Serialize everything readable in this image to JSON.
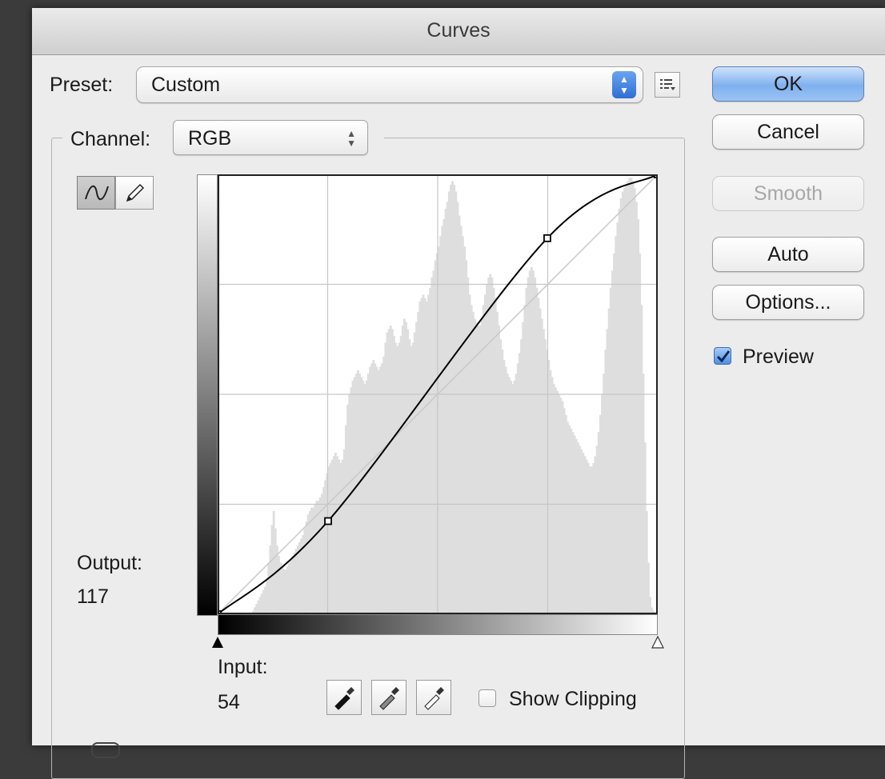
{
  "window": {
    "title": "Curves"
  },
  "preset": {
    "label": "Preset:",
    "value": "Custom"
  },
  "channel": {
    "label": "Channel:",
    "value": "RGB"
  },
  "buttons": {
    "ok": "OK",
    "cancel": "Cancel",
    "smooth": "Smooth",
    "auto": "Auto",
    "options": "Options..."
  },
  "preview": {
    "label": "Preview",
    "checked": true
  },
  "output": {
    "label": "Output:",
    "value": "117"
  },
  "input": {
    "label": "Input:",
    "value": "54"
  },
  "show_clipping": {
    "label": "Show Clipping",
    "checked": false
  },
  "tools": {
    "curve_tool": "curve-point-tool-icon",
    "pencil_tool": "pencil-icon"
  },
  "eyedroppers": [
    "black-point-eyedropper-icon",
    "gray-point-eyedropper-icon",
    "white-point-eyedropper-icon"
  ],
  "colors": {
    "accent": "#4e8fe0",
    "curve": "#000000",
    "histogram": "#dedede",
    "grid": "#c6c6c6"
  },
  "curve_points": [
    {
      "input": 0,
      "output": 0
    },
    {
      "input": 64,
      "output": 54
    },
    {
      "input": 191,
      "output": 218
    },
    {
      "input": 255,
      "output": 255
    }
  ],
  "histogram": [
    0,
    0,
    0,
    0,
    0,
    0,
    0,
    0,
    0,
    0,
    0,
    0,
    0,
    0,
    0,
    0,
    0,
    0,
    0,
    0,
    2,
    4,
    6,
    8,
    10,
    12,
    14,
    16,
    20,
    30,
    40,
    52,
    60,
    50,
    40,
    34,
    30,
    28,
    26,
    26,
    28,
    30,
    32,
    34,
    36,
    38,
    40,
    42,
    44,
    46,
    50,
    54,
    58,
    60,
    62,
    62,
    64,
    66,
    66,
    68,
    70,
    74,
    78,
    82,
    86,
    88,
    90,
    92,
    94,
    92,
    90,
    88,
    90,
    96,
    110,
    122,
    128,
    132,
    136,
    138,
    140,
    142,
    140,
    138,
    136,
    134,
    136,
    140,
    144,
    146,
    148,
    146,
    144,
    142,
    144,
    146,
    150,
    158,
    164,
    166,
    168,
    166,
    162,
    158,
    156,
    158,
    162,
    168,
    172,
    170,
    166,
    160,
    156,
    158,
    164,
    170,
    176,
    182,
    184,
    186,
    184,
    182,
    186,
    190,
    196,
    200,
    206,
    210,
    214,
    220,
    226,
    230,
    236,
    240,
    246,
    250,
    252,
    250,
    246,
    240,
    232,
    226,
    220,
    214,
    206,
    196,
    186,
    180,
    176,
    172,
    170,
    168,
    168,
    172,
    180,
    186,
    192,
    196,
    198,
    196,
    190,
    184,
    176,
    168,
    160,
    154,
    148,
    144,
    140,
    138,
    136,
    134,
    136,
    140,
    146,
    152,
    160,
    170,
    180,
    190,
    196,
    200,
    202,
    200,
    196,
    190,
    184,
    178,
    172,
    166,
    160,
    154,
    148,
    142,
    138,
    134,
    132,
    130,
    128,
    126,
    124,
    120,
    116,
    112,
    110,
    108,
    106,
    104,
    102,
    100,
    98,
    96,
    94,
    92,
    90,
    88,
    86,
    86,
    88,
    92,
    98,
    106,
    116,
    128,
    140,
    154,
    166,
    178,
    190,
    200,
    210,
    220,
    228,
    236,
    242,
    246,
    248,
    250,
    252,
    254,
    254,
    252,
    248,
    240,
    230,
    210,
    180,
    140,
    100,
    60,
    30,
    10,
    4,
    2,
    0,
    0
  ]
}
